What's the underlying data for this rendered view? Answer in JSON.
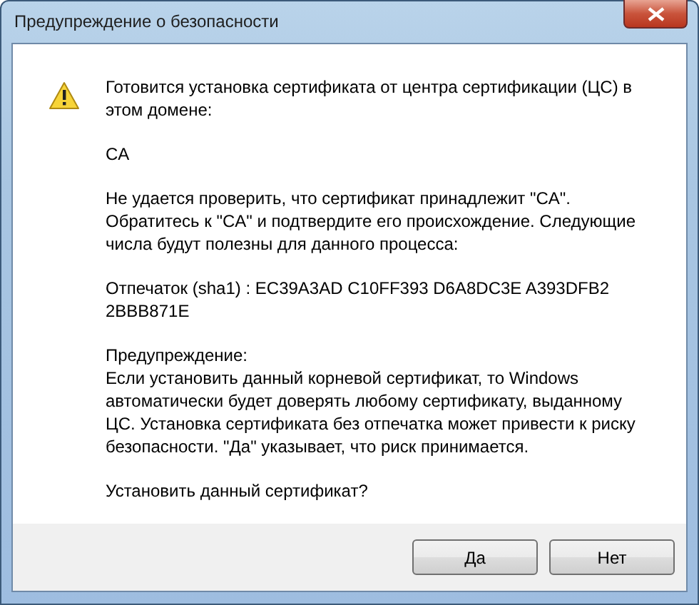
{
  "window": {
    "title": "Предупреждение о безопасности"
  },
  "paragraphs": [
    "Готовится установка сертификата от центра сертификации (ЦС) в этом домене:",
    "CA",
    "Не удается проверить, что сертификат принадлежит \"CA\". Обратитесь к \"CA\" и подтвердите его происхождение. Следующие числа будут полезны для данного процесса:",
    "Отпечаток (sha1) : EC39A3AD C10FF393 D6A8DC3E A393DFB2 2BBB871E",
    "Предупреждение:\nЕсли установить данный корневой сертификат, то Windows автоматически будет доверять любому сертификату, выданному ЦС. Установка сертификата без отпечатка может привести к риску безопасности. \"Да\" указывает, что риск принимается.",
    "Установить данный сертификат?"
  ],
  "buttons": [
    {
      "label": "Да",
      "selected": false
    },
    {
      "label": "Нет",
      "selected": false
    }
  ]
}
